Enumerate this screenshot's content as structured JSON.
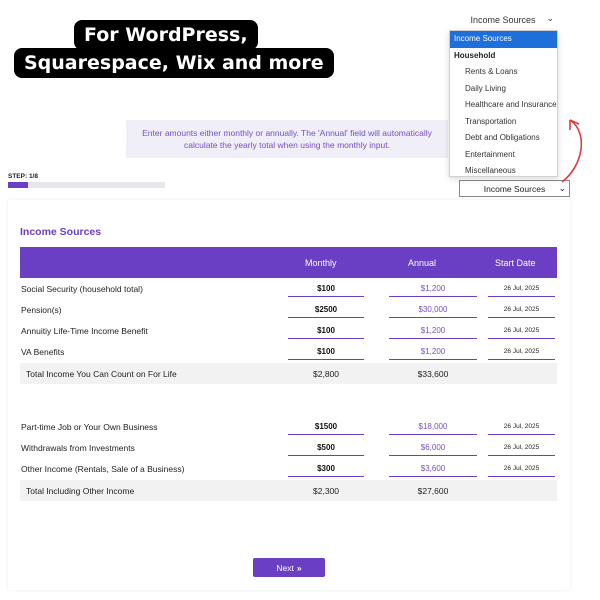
{
  "promo": {
    "line1": "For WordPress,",
    "line2": "Squarespace, Wix and more"
  },
  "top_select": {
    "value": "Income Sources"
  },
  "dropdown": {
    "selected": "Income Sources",
    "group": "Household",
    "items": [
      "Rents & Loans",
      "Daily Living",
      "Healthcare and Insurance",
      "Transportation",
      "Debt and Obligations",
      "Entertainment",
      "Miscellaneous"
    ]
  },
  "info": {
    "text": "Enter amounts either monthly or annually. The 'Annual' field will automatically calculate the yearly total when using the monthly input."
  },
  "step": {
    "label": "STEP: 1/8",
    "progress": 0.125
  },
  "bottom_select": {
    "value": "Income Sources"
  },
  "section": {
    "title": "Income Sources"
  },
  "table": {
    "headers": {
      "monthly": "Monthly",
      "annual": "Annual",
      "start_date": "Start Date"
    },
    "group1": [
      {
        "label": "Social Security (household total)",
        "monthly": "$100",
        "annual": "$1,200",
        "date": "26 Jul, 2025"
      },
      {
        "label": "Pension(s)",
        "monthly": "$2500",
        "annual": "$30,000",
        "date": "26 Jul, 2025"
      },
      {
        "label": "Annuitiy Life-Time Income Benefit",
        "monthly": "$100",
        "annual": "$1,200",
        "date": "26 Jul, 2025"
      },
      {
        "label": "VA Benefits",
        "monthly": "$100",
        "annual": "$1,200",
        "date": "26 Jul, 2025"
      }
    ],
    "total1": {
      "label": "Total Income You Can Count on For Life",
      "monthly": "$2,800",
      "annual": "$33,600"
    },
    "group2": [
      {
        "label": "Part-time Job or Your Own Business",
        "monthly": "$1500",
        "annual": "$18,000",
        "date": "26 Jul, 2025"
      },
      {
        "label": "Withdrawals from Investments",
        "monthly": "$500",
        "annual": "$6,000",
        "date": "26 Jul, 2025"
      },
      {
        "label": "Other Income (Rentals, Sale of a Business)",
        "monthly": "$300",
        "annual": "$3,600",
        "date": "26 Jul, 2025"
      }
    ],
    "total2": {
      "label": "Total Including Other Income",
      "monthly": "$2,300",
      "annual": "$27,600"
    }
  },
  "next_button": {
    "label": "Next",
    "icon": "double-chevron-right-icon"
  },
  "colors": {
    "accent": "#6b3fc4",
    "dropdown_selected": "#1e6fd9",
    "arrow": "#e23b3b"
  }
}
